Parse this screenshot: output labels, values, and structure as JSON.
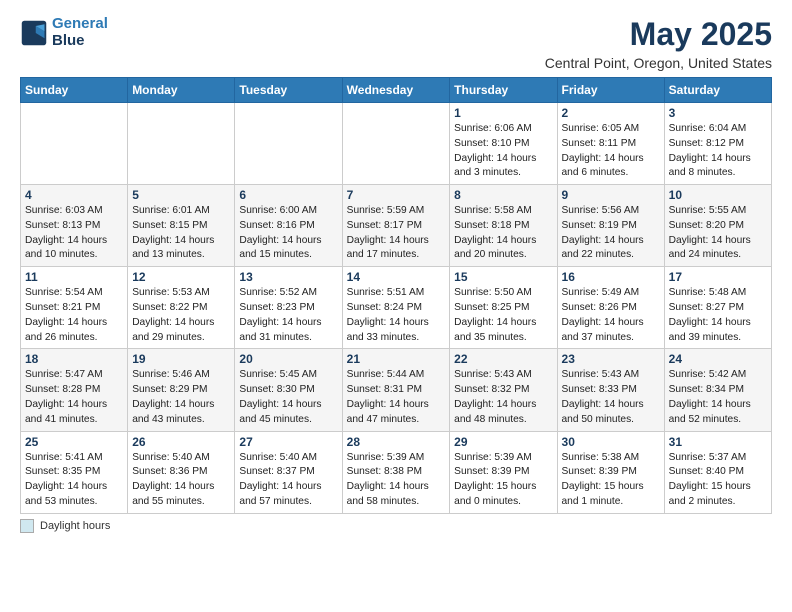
{
  "logo": {
    "line1": "General",
    "line2": "Blue"
  },
  "title": "May 2025",
  "subtitle": "Central Point, Oregon, United States",
  "days_header": [
    "Sunday",
    "Monday",
    "Tuesday",
    "Wednesday",
    "Thursday",
    "Friday",
    "Saturday"
  ],
  "footer_legend": "Daylight hours",
  "weeks": [
    [
      {
        "day": "",
        "info": ""
      },
      {
        "day": "",
        "info": ""
      },
      {
        "day": "",
        "info": ""
      },
      {
        "day": "",
        "info": ""
      },
      {
        "day": "1",
        "info": "Sunrise: 6:06 AM\nSunset: 8:10 PM\nDaylight: 14 hours\nand 3 minutes."
      },
      {
        "day": "2",
        "info": "Sunrise: 6:05 AM\nSunset: 8:11 PM\nDaylight: 14 hours\nand 6 minutes."
      },
      {
        "day": "3",
        "info": "Sunrise: 6:04 AM\nSunset: 8:12 PM\nDaylight: 14 hours\nand 8 minutes."
      }
    ],
    [
      {
        "day": "4",
        "info": "Sunrise: 6:03 AM\nSunset: 8:13 PM\nDaylight: 14 hours\nand 10 minutes."
      },
      {
        "day": "5",
        "info": "Sunrise: 6:01 AM\nSunset: 8:15 PM\nDaylight: 14 hours\nand 13 minutes."
      },
      {
        "day": "6",
        "info": "Sunrise: 6:00 AM\nSunset: 8:16 PM\nDaylight: 14 hours\nand 15 minutes."
      },
      {
        "day": "7",
        "info": "Sunrise: 5:59 AM\nSunset: 8:17 PM\nDaylight: 14 hours\nand 17 minutes."
      },
      {
        "day": "8",
        "info": "Sunrise: 5:58 AM\nSunset: 8:18 PM\nDaylight: 14 hours\nand 20 minutes."
      },
      {
        "day": "9",
        "info": "Sunrise: 5:56 AM\nSunset: 8:19 PM\nDaylight: 14 hours\nand 22 minutes."
      },
      {
        "day": "10",
        "info": "Sunrise: 5:55 AM\nSunset: 8:20 PM\nDaylight: 14 hours\nand 24 minutes."
      }
    ],
    [
      {
        "day": "11",
        "info": "Sunrise: 5:54 AM\nSunset: 8:21 PM\nDaylight: 14 hours\nand 26 minutes."
      },
      {
        "day": "12",
        "info": "Sunrise: 5:53 AM\nSunset: 8:22 PM\nDaylight: 14 hours\nand 29 minutes."
      },
      {
        "day": "13",
        "info": "Sunrise: 5:52 AM\nSunset: 8:23 PM\nDaylight: 14 hours\nand 31 minutes."
      },
      {
        "day": "14",
        "info": "Sunrise: 5:51 AM\nSunset: 8:24 PM\nDaylight: 14 hours\nand 33 minutes."
      },
      {
        "day": "15",
        "info": "Sunrise: 5:50 AM\nSunset: 8:25 PM\nDaylight: 14 hours\nand 35 minutes."
      },
      {
        "day": "16",
        "info": "Sunrise: 5:49 AM\nSunset: 8:26 PM\nDaylight: 14 hours\nand 37 minutes."
      },
      {
        "day": "17",
        "info": "Sunrise: 5:48 AM\nSunset: 8:27 PM\nDaylight: 14 hours\nand 39 minutes."
      }
    ],
    [
      {
        "day": "18",
        "info": "Sunrise: 5:47 AM\nSunset: 8:28 PM\nDaylight: 14 hours\nand 41 minutes."
      },
      {
        "day": "19",
        "info": "Sunrise: 5:46 AM\nSunset: 8:29 PM\nDaylight: 14 hours\nand 43 minutes."
      },
      {
        "day": "20",
        "info": "Sunrise: 5:45 AM\nSunset: 8:30 PM\nDaylight: 14 hours\nand 45 minutes."
      },
      {
        "day": "21",
        "info": "Sunrise: 5:44 AM\nSunset: 8:31 PM\nDaylight: 14 hours\nand 47 minutes."
      },
      {
        "day": "22",
        "info": "Sunrise: 5:43 AM\nSunset: 8:32 PM\nDaylight: 14 hours\nand 48 minutes."
      },
      {
        "day": "23",
        "info": "Sunrise: 5:43 AM\nSunset: 8:33 PM\nDaylight: 14 hours\nand 50 minutes."
      },
      {
        "day": "24",
        "info": "Sunrise: 5:42 AM\nSunset: 8:34 PM\nDaylight: 14 hours\nand 52 minutes."
      }
    ],
    [
      {
        "day": "25",
        "info": "Sunrise: 5:41 AM\nSunset: 8:35 PM\nDaylight: 14 hours\nand 53 minutes."
      },
      {
        "day": "26",
        "info": "Sunrise: 5:40 AM\nSunset: 8:36 PM\nDaylight: 14 hours\nand 55 minutes."
      },
      {
        "day": "27",
        "info": "Sunrise: 5:40 AM\nSunset: 8:37 PM\nDaylight: 14 hours\nand 57 minutes."
      },
      {
        "day": "28",
        "info": "Sunrise: 5:39 AM\nSunset: 8:38 PM\nDaylight: 14 hours\nand 58 minutes."
      },
      {
        "day": "29",
        "info": "Sunrise: 5:39 AM\nSunset: 8:39 PM\nDaylight: 15 hours\nand 0 minutes."
      },
      {
        "day": "30",
        "info": "Sunrise: 5:38 AM\nSunset: 8:39 PM\nDaylight: 15 hours\nand 1 minute."
      },
      {
        "day": "31",
        "info": "Sunrise: 5:37 AM\nSunset: 8:40 PM\nDaylight: 15 hours\nand 2 minutes."
      }
    ]
  ]
}
